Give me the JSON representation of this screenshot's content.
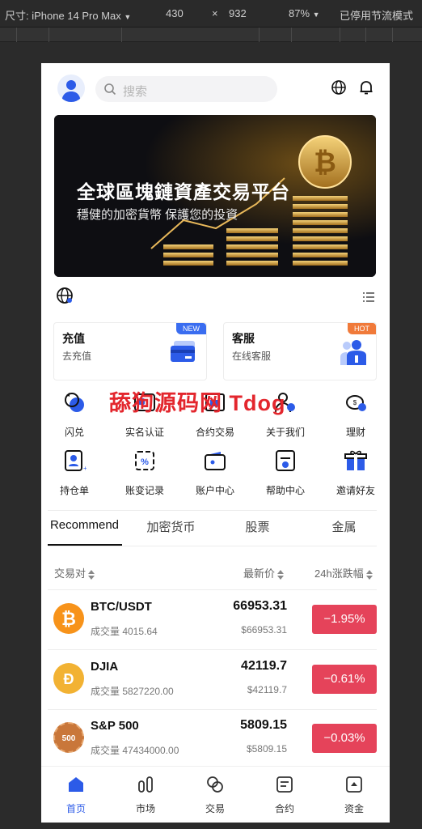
{
  "devtools": {
    "device_label": "尺寸: iPhone 14 Pro Max",
    "width": "430",
    "times": "×",
    "height": "932",
    "zoom": "87%",
    "throttle": "已停用节流模式"
  },
  "header": {
    "search_placeholder": "搜索"
  },
  "banner": {
    "title": "全球區塊鏈資產交易平台",
    "subtitle": "穩健的加密貨幣 保護您的投資"
  },
  "cards": [
    {
      "title": "充值",
      "subtitle": "去充值",
      "badge": "NEW",
      "badge_color": "#3a6df0"
    },
    {
      "title": "客服",
      "subtitle": "在线客服",
      "badge": "HOT",
      "badge_color": "#f07a3a"
    }
  ],
  "grid": [
    {
      "label": "闪兑",
      "icon": "exchange-icon"
    },
    {
      "label": "实名认证",
      "icon": "id-card-icon"
    },
    {
      "label": "合约交易",
      "icon": "contract-icon"
    },
    {
      "label": "关于我们",
      "icon": "people-icon"
    },
    {
      "label": "理财",
      "icon": "piggy-bank-icon"
    },
    {
      "label": "持仓单",
      "icon": "position-icon"
    },
    {
      "label": "账变记录",
      "icon": "record-icon"
    },
    {
      "label": "账户中心",
      "icon": "wallet-icon"
    },
    {
      "label": "帮助中心",
      "icon": "help-icon"
    },
    {
      "label": "邀请好友",
      "icon": "gift-icon"
    }
  ],
  "watermark": "舔狗源码网 Tdog",
  "tabs": [
    "Recommend",
    "加密货币",
    "股票",
    "金属"
  ],
  "table": {
    "headers": [
      "交易对",
      "最新价",
      "24h涨跌幅"
    ],
    "rows": [
      {
        "pair": "BTC/USDT",
        "volume": "成交量 4015.64",
        "price": "66953.31",
        "fiat": "$66953.31",
        "change": "−1.95%",
        "coin_color": "#f7931a"
      },
      {
        "pair": "DJIA",
        "volume": "成交量 5827220.00",
        "price": "42119.7",
        "fiat": "$42119.7",
        "change": "−0.61%",
        "coin_color": "#f2b233"
      },
      {
        "pair": "S&P 500",
        "volume": "成交量 47434000.00",
        "price": "5809.15",
        "fiat": "$5809.15",
        "change": "−0.03%",
        "coin_color": "#c9773a"
      }
    ]
  },
  "bottom_nav": [
    {
      "label": "首页",
      "icon": "home-icon"
    },
    {
      "label": "市场",
      "icon": "market-icon"
    },
    {
      "label": "交易",
      "icon": "trade-icon"
    },
    {
      "label": "合约",
      "icon": "contract-nav-icon"
    },
    {
      "label": "资金",
      "icon": "funds-icon"
    }
  ],
  "colors": {
    "accent": "#2c5be8",
    "down": "#e5435a"
  }
}
